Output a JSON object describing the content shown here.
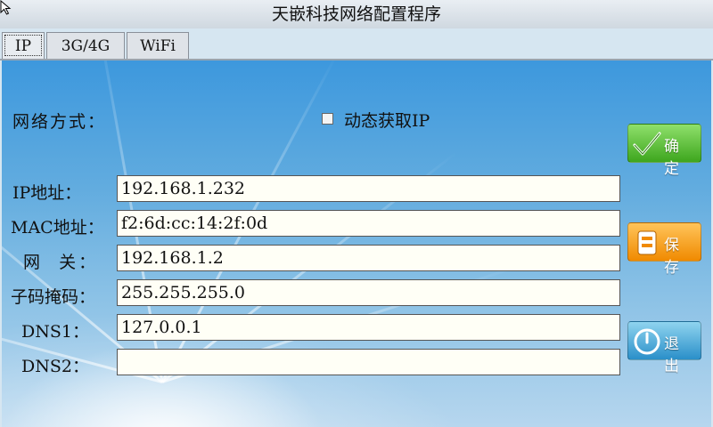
{
  "window": {
    "title": "天嵌科技网络配置程序"
  },
  "tabs": [
    {
      "label": "IP",
      "active": true
    },
    {
      "label": "3G/4G",
      "active": false
    },
    {
      "label": "WiFi",
      "active": false
    }
  ],
  "network": {
    "mode_label": "网络方式：",
    "dhcp_label": "动态获取IP",
    "dhcp_checked": false
  },
  "fields": [
    {
      "label": "IP地址：",
      "value": "192.168.1.232"
    },
    {
      "label": "MAC地址：",
      "value": "f2:6d:cc:14:2f:0d"
    },
    {
      "label": "网  关：",
      "value": "192.168.1.2"
    },
    {
      "label": "子码掩码：",
      "value": "255.255.255.0"
    },
    {
      "label": "DNS1：",
      "value": "127.0.0.1"
    },
    {
      "label": "DNS2：",
      "value": ""
    }
  ],
  "buttons": {
    "ok": {
      "label": "确定",
      "icon": "checkmark-icon",
      "color": "#3ea61e"
    },
    "save": {
      "label": "保存",
      "icon": "save-icon",
      "color": "#f08a00"
    },
    "exit": {
      "label": "退出",
      "icon": "exit-icon",
      "color": "#2a8fc9"
    }
  }
}
